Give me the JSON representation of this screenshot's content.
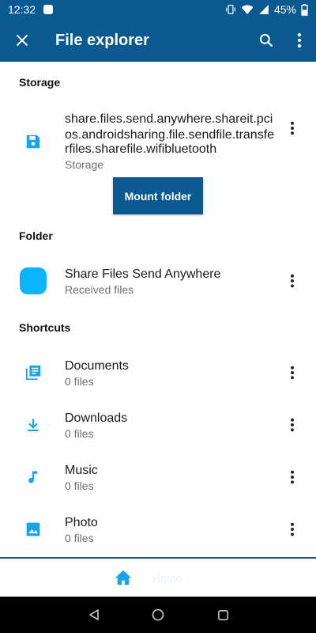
{
  "status_bar": {
    "time": "12:32",
    "battery": "45%"
  },
  "app_bar": {
    "title": "File explorer",
    "icons": [
      "close-icon",
      "search-icon",
      "more-vert-icon"
    ]
  },
  "sections": {
    "storage": {
      "title": "Storage",
      "item": {
        "title_lines": [
          "share.files.send.anywhere.shareit.pci",
          "os.androidsharing.file.sendfile.transfe",
          "rfiles.sharefile.wifibluetooth"
        ],
        "subtitle": "Storage",
        "icon": "sd-card-icon"
      },
      "mount_button": "Mount folder"
    },
    "folder": {
      "title": "Folder",
      "item": {
        "title": "Share Files Send Anywhere",
        "subtitle": "Received files",
        "icon": "folder-square-icon"
      }
    },
    "shortcuts": {
      "title": "Shortcuts",
      "items": [
        {
          "title": "Documents",
          "subtitle": "0 files",
          "icon": "documents-icon"
        },
        {
          "title": "Downloads",
          "subtitle": "0 files",
          "icon": "download-icon"
        },
        {
          "title": "Music",
          "subtitle": "0 files",
          "icon": "music-note-icon"
        },
        {
          "title": "Photo",
          "subtitle": "0 files",
          "icon": "image-icon"
        }
      ]
    }
  },
  "bottom_nav": {
    "home_label": "Home"
  },
  "colors": {
    "primary": "#0a5a91",
    "accent": "#1aa3e8"
  }
}
